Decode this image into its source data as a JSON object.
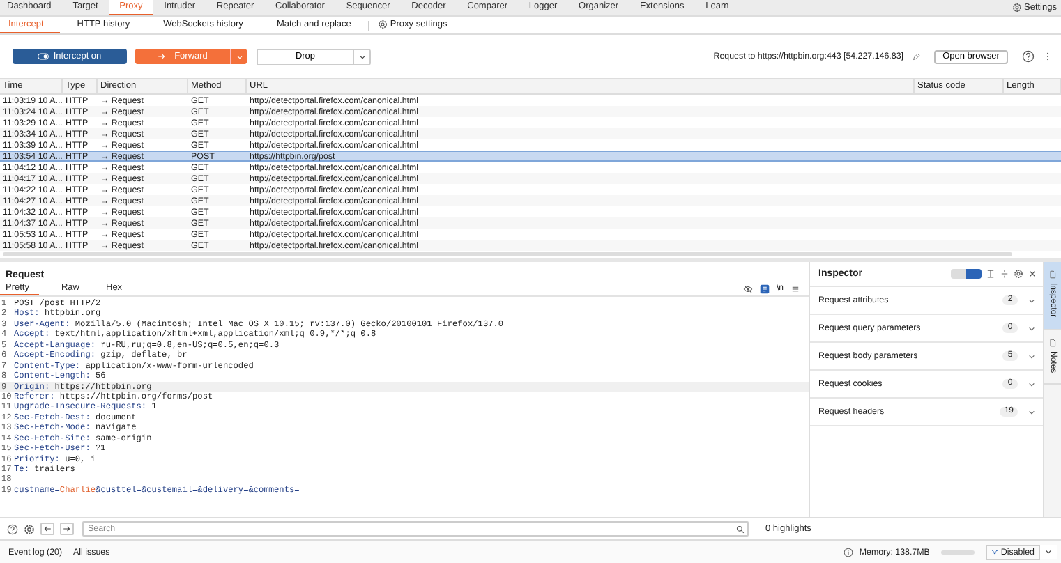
{
  "top_tabs": [
    {
      "label": "Dashboard",
      "selected": false
    },
    {
      "label": "Target",
      "selected": false
    },
    {
      "label": "Proxy",
      "selected": true
    },
    {
      "label": "Intruder",
      "selected": false
    },
    {
      "label": "Repeater",
      "selected": false
    },
    {
      "label": "Collaborator",
      "selected": false
    },
    {
      "label": "Sequencer",
      "selected": false
    },
    {
      "label": "Decoder",
      "selected": false
    },
    {
      "label": "Comparer",
      "selected": false
    },
    {
      "label": "Logger",
      "selected": false
    },
    {
      "label": "Organizer",
      "selected": false
    },
    {
      "label": "Extensions",
      "selected": false
    },
    {
      "label": "Learn",
      "selected": false
    }
  ],
  "settings_label": "Settings",
  "sub_tabs": [
    {
      "label": "Intercept",
      "selected": true
    },
    {
      "label": "HTTP history",
      "selected": false
    },
    {
      "label": "WebSockets history",
      "selected": false
    },
    {
      "label": "Match and replace",
      "selected": false
    }
  ],
  "proxy_settings_label": "Proxy settings",
  "toolbar": {
    "intercept": {
      "label": "Intercept on",
      "on": true
    },
    "forward": "Forward",
    "drop": "Drop",
    "request_target": "Request to https://httpbin.org:443  [54.227.146.83]",
    "open_browser": "Open browser"
  },
  "table": {
    "columns": [
      "Time",
      "Type",
      "Direction",
      "Method",
      "URL",
      "Status code",
      "Length"
    ],
    "rows": [
      {
        "time": "11:03:19 10 A...",
        "type": "HTTP",
        "direction": "→  Request",
        "method": "GET",
        "url": "http://detectportal.firefox.com/canonical.html",
        "selected": false
      },
      {
        "time": "11:03:24 10 A...",
        "type": "HTTP",
        "direction": "→  Request",
        "method": "GET",
        "url": "http://detectportal.firefox.com/canonical.html",
        "selected": false
      },
      {
        "time": "11:03:29 10 A...",
        "type": "HTTP",
        "direction": "→  Request",
        "method": "GET",
        "url": "http://detectportal.firefox.com/canonical.html",
        "selected": false
      },
      {
        "time": "11:03:34 10 A...",
        "type": "HTTP",
        "direction": "→  Request",
        "method": "GET",
        "url": "http://detectportal.firefox.com/canonical.html",
        "selected": false
      },
      {
        "time": "11:03:39 10 A...",
        "type": "HTTP",
        "direction": "→  Request",
        "method": "GET",
        "url": "http://detectportal.firefox.com/canonical.html",
        "selected": false
      },
      {
        "time": "11:03:54 10 A...",
        "type": "HTTP",
        "direction": "→  Request",
        "method": "POST",
        "url": "https://httpbin.org/post",
        "selected": true
      },
      {
        "time": "11:04:12 10 A...",
        "type": "HTTP",
        "direction": "→  Request",
        "method": "GET",
        "url": "http://detectportal.firefox.com/canonical.html",
        "selected": false
      },
      {
        "time": "11:04:17 10 A...",
        "type": "HTTP",
        "direction": "→  Request",
        "method": "GET",
        "url": "http://detectportal.firefox.com/canonical.html",
        "selected": false
      },
      {
        "time": "11:04:22 10 A...",
        "type": "HTTP",
        "direction": "→  Request",
        "method": "GET",
        "url": "http://detectportal.firefox.com/canonical.html",
        "selected": false
      },
      {
        "time": "11:04:27 10 A...",
        "type": "HTTP",
        "direction": "→  Request",
        "method": "GET",
        "url": "http://detectportal.firefox.com/canonical.html",
        "selected": false
      },
      {
        "time": "11:04:32 10 A...",
        "type": "HTTP",
        "direction": "→  Request",
        "method": "GET",
        "url": "http://detectportal.firefox.com/canonical.html",
        "selected": false
      },
      {
        "time": "11:04:37 10 A...",
        "type": "HTTP",
        "direction": "→  Request",
        "method": "GET",
        "url": "http://detectportal.firefox.com/canonical.html",
        "selected": false
      },
      {
        "time": "11:05:53 10 A...",
        "type": "HTTP",
        "direction": "→  Request",
        "method": "GET",
        "url": "http://detectportal.firefox.com/canonical.html",
        "selected": false
      },
      {
        "time": "11:05:58 10 A...",
        "type": "HTTP",
        "direction": "→  Request",
        "method": "GET",
        "url": "http://detectportal.firefox.com/canonical.html",
        "selected": false
      }
    ]
  },
  "request": {
    "title": "Request",
    "tabs": [
      {
        "label": "Pretty",
        "selected": true
      },
      {
        "label": "Raw",
        "selected": false
      },
      {
        "label": "Hex",
        "selected": false
      }
    ],
    "newline_toggle": "\\n",
    "lines": [
      {
        "number": "1",
        "kind": "plain",
        "text": "POST /post HTTP/2",
        "highlighted": false
      },
      {
        "number": "2",
        "kind": "header",
        "name": "Host:",
        "text": "httpbin.org",
        "highlighted": false
      },
      {
        "number": "3",
        "kind": "header",
        "name": "User-Agent:",
        "text": "Mozilla/5.0 (Macintosh; Intel Mac OS X 10.15; rv:137.0) Gecko/20100101 Firefox/137.0",
        "highlighted": false
      },
      {
        "number": "4",
        "kind": "header",
        "name": "Accept:",
        "text": "text/html,application/xhtml+xml,application/xml;q=0.9,*/*;q=0.8",
        "highlighted": false
      },
      {
        "number": "5",
        "kind": "header",
        "name": "Accept-Language:",
        "text": "ru-RU,ru;q=0.8,en-US;q=0.5,en;q=0.3",
        "highlighted": false
      },
      {
        "number": "6",
        "kind": "header",
        "name": "Accept-Encoding:",
        "text": "gzip, deflate, br",
        "highlighted": false
      },
      {
        "number": "7",
        "kind": "header",
        "name": "Content-Type:",
        "text": "application/x-www-form-urlencoded",
        "highlighted": false
      },
      {
        "number": "8",
        "kind": "header",
        "name": "Content-Length:",
        "text": "56",
        "highlighted": false
      },
      {
        "number": "9",
        "kind": "header",
        "name": "Origin:",
        "text": "https://httpbin.org",
        "highlighted": true
      },
      {
        "number": "10",
        "kind": "header",
        "name": "Referer:",
        "text": "https://httpbin.org/forms/post",
        "highlighted": false
      },
      {
        "number": "11",
        "kind": "header",
        "name": "Upgrade-Insecure-Requests:",
        "text": "1",
        "highlighted": false
      },
      {
        "number": "12",
        "kind": "header",
        "name": "Sec-Fetch-Dest:",
        "text": "document",
        "highlighted": false
      },
      {
        "number": "13",
        "kind": "header",
        "name": "Sec-Fetch-Mode:",
        "text": "navigate",
        "highlighted": false
      },
      {
        "number": "14",
        "kind": "header",
        "name": "Sec-Fetch-Site:",
        "text": "same-origin",
        "highlighted": false
      },
      {
        "number": "15",
        "kind": "header",
        "name": "Sec-Fetch-User:",
        "text": "?1",
        "highlighted": false
      },
      {
        "number": "16",
        "kind": "header",
        "name": "Priority:",
        "text": "u=0, i",
        "highlighted": false
      },
      {
        "number": "17",
        "kind": "header",
        "name": "Te:",
        "text": "trailers",
        "highlighted": false
      },
      {
        "number": "18",
        "kind": "blank",
        "highlighted": false
      },
      {
        "number": "19",
        "kind": "body",
        "segments": [
          {
            "kind": "name",
            "text": "custname="
          },
          {
            "kind": "value",
            "text": "Charlie"
          },
          {
            "kind": "name",
            "text": "&custtel=&custemail=&delivery=&comments="
          }
        ],
        "highlighted": false
      }
    ]
  },
  "search": {
    "placeholder": "Search",
    "highlights": "0 highlights"
  },
  "inspector": {
    "title": "Inspector",
    "sections": [
      {
        "label": "Request attributes",
        "count": "2"
      },
      {
        "label": "Request query parameters",
        "count": "0"
      },
      {
        "label": "Request body parameters",
        "count": "5"
      },
      {
        "label": "Request cookies",
        "count": "0"
      },
      {
        "label": "Request headers",
        "count": "19"
      }
    ]
  },
  "side_tabs": [
    {
      "label": "Inspector",
      "selected": true
    },
    {
      "label": "Notes",
      "selected": false
    }
  ],
  "status_bar": {
    "event_log": "Event log (20)",
    "all_issues": "All issues",
    "memory": "Memory: 138.7MB",
    "mode": "Disabled"
  }
}
